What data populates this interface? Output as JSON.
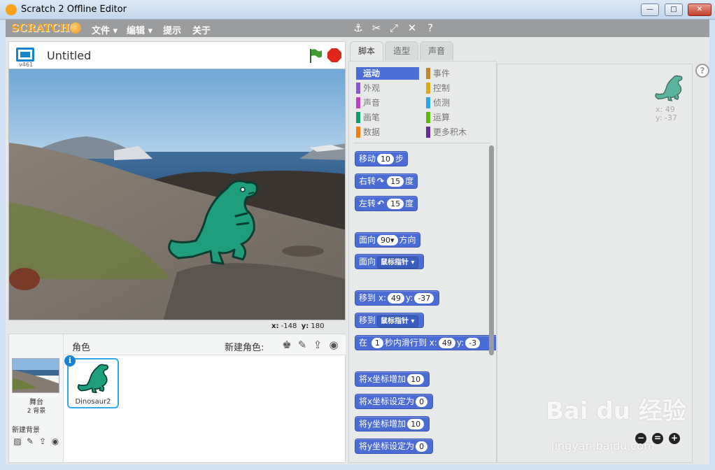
{
  "window": {
    "title": "Scratch 2 Offline Editor",
    "min_label": "—",
    "max_label": "□",
    "close_label": "✕"
  },
  "menubar": {
    "logo": "SCRATCH",
    "items": [
      "文件",
      "编辑",
      "提示",
      "关于"
    ],
    "tools": [
      "duplicate-stamp-icon",
      "delete-cut-icon",
      "grow-icon",
      "shrink-icon",
      "block-help-icon"
    ]
  },
  "stage_header": {
    "version": "v461",
    "project_title": "Untitled"
  },
  "stage": {
    "mouse_x_label": "x:",
    "mouse_x": "-148",
    "mouse_y_label": "y:",
    "mouse_y": "180"
  },
  "sprites": {
    "header_label": "角色",
    "new_sprite_label": "新建角色:",
    "stage_label": "舞台",
    "stage_backdrops": "2 背景",
    "new_backdrop_label": "新建背景",
    "sprite_list": [
      {
        "name": "Dinosaur2"
      }
    ]
  },
  "tabs": [
    {
      "label": "脚本",
      "active": true
    },
    {
      "label": "造型",
      "active": false
    },
    {
      "label": "声音",
      "active": false
    }
  ],
  "categories": [
    {
      "label": "运动",
      "color": "#4a6cd4",
      "active": true
    },
    {
      "label": "外观",
      "color": "#8a55d7"
    },
    {
      "label": "声音",
      "color": "#bb42c3"
    },
    {
      "label": "画笔",
      "color": "#0e9a6c"
    },
    {
      "label": "数据",
      "color": "#ee7d16"
    },
    {
      "label": "事件",
      "color": "#c88330"
    },
    {
      "label": "控制",
      "color": "#e1a91a"
    },
    {
      "label": "侦测",
      "color": "#2ca5e2"
    },
    {
      "label": "运算",
      "color": "#5cb712"
    },
    {
      "label": "更多积木",
      "color": "#632d99"
    }
  ],
  "blocks": {
    "move": {
      "pre": "移动",
      "val": "10",
      "post": "步"
    },
    "turn_right": {
      "pre": "右转",
      "glyph": "↷",
      "val": "15",
      "post": "度"
    },
    "turn_left": {
      "pre": "左转",
      "glyph": "↶",
      "val": "15",
      "post": "度"
    },
    "point_dir": {
      "pre": "面向",
      "val": "90▾",
      "post": "方向"
    },
    "point_towards": {
      "pre": "面向",
      "dd": "鼠标指针 ▾"
    },
    "goto_xy": {
      "pre": "移到",
      "xl": "x:",
      "x": "49",
      "yl": "y:",
      "y": "-37"
    },
    "goto_target": {
      "pre": "移到",
      "dd": "鼠标指针 ▾"
    },
    "glide": {
      "pre": "在",
      "val": "1",
      "mid": "秒内滑行到",
      "xl": "x:",
      "x": "49",
      "yl": "y:",
      "y": "-3"
    },
    "change_x": {
      "pre": "将x坐标增加",
      "val": "10"
    },
    "set_x": {
      "pre": "将x坐标设定为",
      "val": "0"
    },
    "change_y": {
      "pre": "将y坐标增加",
      "val": "10"
    },
    "set_y": {
      "pre": "将y坐标设定为",
      "val": "0"
    }
  },
  "scripts_area": {
    "sprite_x": "x: 49",
    "sprite_y": "y: -37",
    "help": "?"
  },
  "watermark": {
    "brand": "Bai du 经验",
    "url": "jingyan.baidu.com"
  }
}
